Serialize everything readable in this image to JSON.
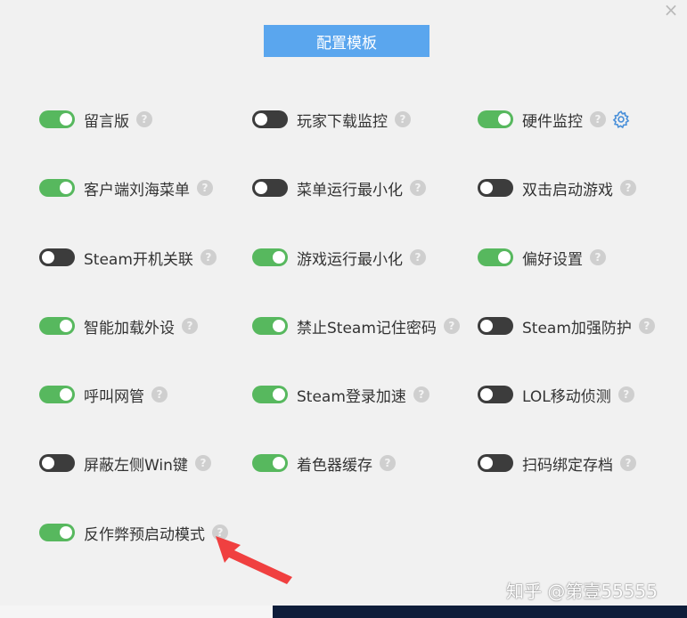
{
  "dialog": {
    "template_button": "配置模板",
    "watermark": "知乎 @第壹55555",
    "colors": {
      "accent": "#5aa6ee",
      "toggle_on": "#57b85e",
      "toggle_off": "#3c3c3c",
      "arrow": "#f04040"
    }
  },
  "options": [
    {
      "label": "留言版",
      "on": true
    },
    {
      "label": "玩家下载监控",
      "on": false
    },
    {
      "label": "硬件监控",
      "on": true,
      "gear": true
    },
    {
      "label": "客户端刘海菜单",
      "on": true
    },
    {
      "label": "菜单运行最小化",
      "on": false
    },
    {
      "label": "双击启动游戏",
      "on": false
    },
    {
      "label": "Steam开机关联",
      "on": false
    },
    {
      "label": "游戏运行最小化",
      "on": true
    },
    {
      "label": "偏好设置",
      "on": true
    },
    {
      "label": "智能加载外设",
      "on": true
    },
    {
      "label": "禁止Steam记住密码",
      "on": true
    },
    {
      "label": "Steam加强防护",
      "on": false
    },
    {
      "label": "呼叫网管",
      "on": true
    },
    {
      "label": "Steam登录加速",
      "on": true
    },
    {
      "label": "LOL移动侦测",
      "on": false
    },
    {
      "label": "屏蔽左侧Win键",
      "on": false
    },
    {
      "label": "着色器缓存",
      "on": true
    },
    {
      "label": "扫码绑定存档",
      "on": false
    },
    {
      "label": "反作弊预启动模式",
      "on": true
    }
  ]
}
